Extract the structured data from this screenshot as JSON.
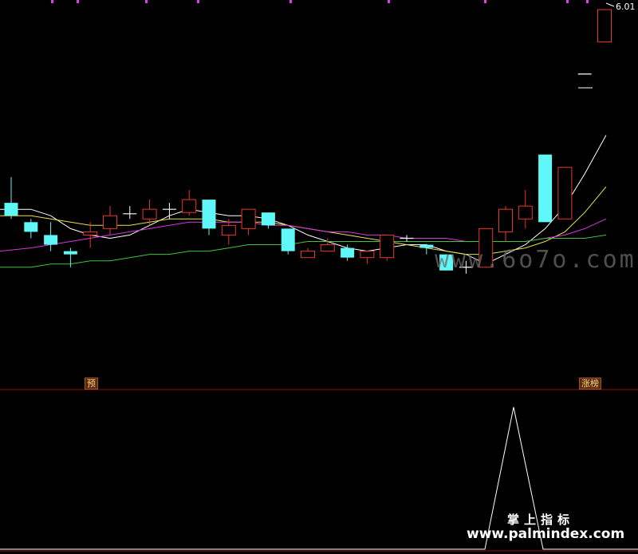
{
  "colors": {
    "background": "#000000",
    "up": "#e8372c",
    "down": "#5ff7f7",
    "ma5": "#ffffff",
    "ma10": "#e8e04a",
    "ma20": "#d838d8",
    "ma60": "#3ec43e",
    "separator": "#8a1414",
    "marker": "#e040e0",
    "indicator": "#ffffff",
    "price_label": "#ffffff"
  },
  "labels": {
    "price_high": "6.01",
    "tag_left": "预",
    "tag_right": "涨榜",
    "watermark_mid": "www.6o7o.com",
    "watermark_cn": "掌上指标",
    "watermark_url": "www.palmindex.com"
  },
  "chart_data": [
    {
      "type": "candlestick",
      "panel": "price",
      "price_range": [
        4.85,
        6.03
      ],
      "candles": [
        {
          "o": 5.41,
          "h": 5.49,
          "l": 5.36,
          "c": 5.37
        },
        {
          "o": 5.35,
          "h": 5.36,
          "l": 5.3,
          "c": 5.32
        },
        {
          "o": 5.31,
          "h": 5.35,
          "l": 5.26,
          "c": 5.28
        },
        {
          "o": 5.26,
          "h": 5.27,
          "l": 5.21,
          "c": 5.25
        },
        {
          "o": 5.31,
          "h": 5.35,
          "l": 5.27,
          "c": 5.32
        },
        {
          "o": 5.33,
          "h": 5.4,
          "l": 5.31,
          "c": 5.37
        },
        {
          "o": 5.376,
          "h": 5.4,
          "l": 5.36,
          "c": 5.376
        },
        {
          "o": 5.36,
          "h": 5.42,
          "l": 5.34,
          "c": 5.39
        },
        {
          "o": 5.39,
          "h": 5.41,
          "l": 5.36,
          "c": 5.39
        },
        {
          "o": 5.38,
          "h": 5.45,
          "l": 5.37,
          "c": 5.42
        },
        {
          "o": 5.42,
          "h": 5.41,
          "l": 5.31,
          "c": 5.33
        },
        {
          "o": 5.31,
          "h": 5.36,
          "l": 5.28,
          "c": 5.34
        },
        {
          "o": 5.33,
          "h": 5.35,
          "l": 5.31,
          "c": 5.39
        },
        {
          "o": 5.38,
          "h": 5.38,
          "l": 5.33,
          "c": 5.34
        },
        {
          "o": 5.33,
          "h": 5.32,
          "l": 5.25,
          "c": 5.26
        },
        {
          "o": 5.24,
          "h": 5.27,
          "l": 5.24,
          "c": 5.26
        },
        {
          "o": 5.26,
          "h": 5.3,
          "l": 5.26,
          "c": 5.28
        },
        {
          "o": 5.27,
          "h": 5.28,
          "l": 5.23,
          "c": 5.24
        },
        {
          "o": 5.24,
          "h": 5.26,
          "l": 5.22,
          "c": 5.26
        },
        {
          "o": 5.24,
          "h": 5.3,
          "l": 5.23,
          "c": 5.31
        },
        {
          "o": 5.3,
          "h": 5.31,
          "l": 5.29,
          "c": 5.3
        },
        {
          "o": 5.28,
          "h": 5.28,
          "l": 5.25,
          "c": 5.27
        },
        {
          "o": 5.25,
          "h": 5.25,
          "l": 5.2,
          "c": 5.2
        },
        {
          "o": 5.21,
          "h": 5.23,
          "l": 5.19,
          "c": 5.21
        },
        {
          "o": 5.21,
          "h": 5.33,
          "l": 5.21,
          "c": 5.33
        },
        {
          "o": 5.32,
          "h": 5.4,
          "l": 5.29,
          "c": 5.39
        },
        {
          "o": 5.36,
          "h": 5.45,
          "l": 5.33,
          "c": 5.4
        },
        {
          "o": 5.56,
          "h": 5.56,
          "l": 5.35,
          "c": 5.35
        },
        {
          "o": 5.36,
          "h": 5.52,
          "l": 5.36,
          "c": 5.52
        },
        {
          "o": 5.81,
          "h": 5.81,
          "l": 5.81,
          "c": 5.81
        },
        {
          "o": 5.91,
          "h": 6.01,
          "l": 5.91,
          "c": 6.01
        }
      ],
      "moving_averages": [
        {
          "period": 5,
          "values": [
            5.39,
            5.39,
            5.37,
            5.33,
            5.31,
            5.3,
            5.31,
            5.34,
            5.37,
            5.39,
            5.38,
            5.37,
            5.37,
            5.36,
            5.34,
            5.31,
            5.29,
            5.27,
            5.26,
            5.27,
            5.28,
            5.28,
            5.26,
            5.25,
            5.22,
            5.25,
            5.28,
            5.33,
            5.4,
            5.5,
            5.62
          ]
        },
        {
          "period": 10,
          "values": [
            5.37,
            5.37,
            5.36,
            5.35,
            5.34,
            5.34,
            5.34,
            5.35,
            5.36,
            5.36,
            5.36,
            5.35,
            5.35,
            5.35,
            5.34,
            5.33,
            5.32,
            5.31,
            5.3,
            5.29,
            5.28,
            5.27,
            5.26,
            5.25,
            5.25,
            5.26,
            5.27,
            5.29,
            5.32,
            5.38,
            5.46
          ]
        },
        {
          "period": 20,
          "values": [
            5.26,
            5.27,
            5.28,
            5.29,
            5.3,
            5.31,
            5.32,
            5.33,
            5.34,
            5.35,
            5.35,
            5.35,
            5.35,
            5.34,
            5.34,
            5.33,
            5.32,
            5.32,
            5.31,
            5.31,
            5.3,
            5.3,
            5.3,
            5.29,
            5.29,
            5.29,
            5.29,
            5.3,
            5.31,
            5.33,
            5.36
          ]
        },
        {
          "period": 60,
          "values": [
            5.21,
            5.21,
            5.22,
            5.22,
            5.23,
            5.23,
            5.24,
            5.25,
            5.25,
            5.26,
            5.26,
            5.27,
            5.28,
            5.28,
            5.28,
            5.29,
            5.29,
            5.29,
            5.29,
            5.29,
            5.29,
            5.29,
            5.29,
            5.29,
            5.29,
            5.29,
            5.29,
            5.3,
            5.3,
            5.3,
            5.31
          ]
        }
      ]
    },
    {
      "type": "line",
      "panel": "indicator",
      "y_range": [
        0,
        1
      ],
      "values": [
        0,
        0,
        0,
        0,
        0,
        0,
        0,
        0,
        0,
        0,
        0,
        0,
        0,
        0,
        0,
        0,
        0,
        0,
        0,
        0,
        0,
        0,
        0,
        0,
        0,
        1,
        0,
        0,
        0,
        0,
        0
      ]
    }
  ]
}
